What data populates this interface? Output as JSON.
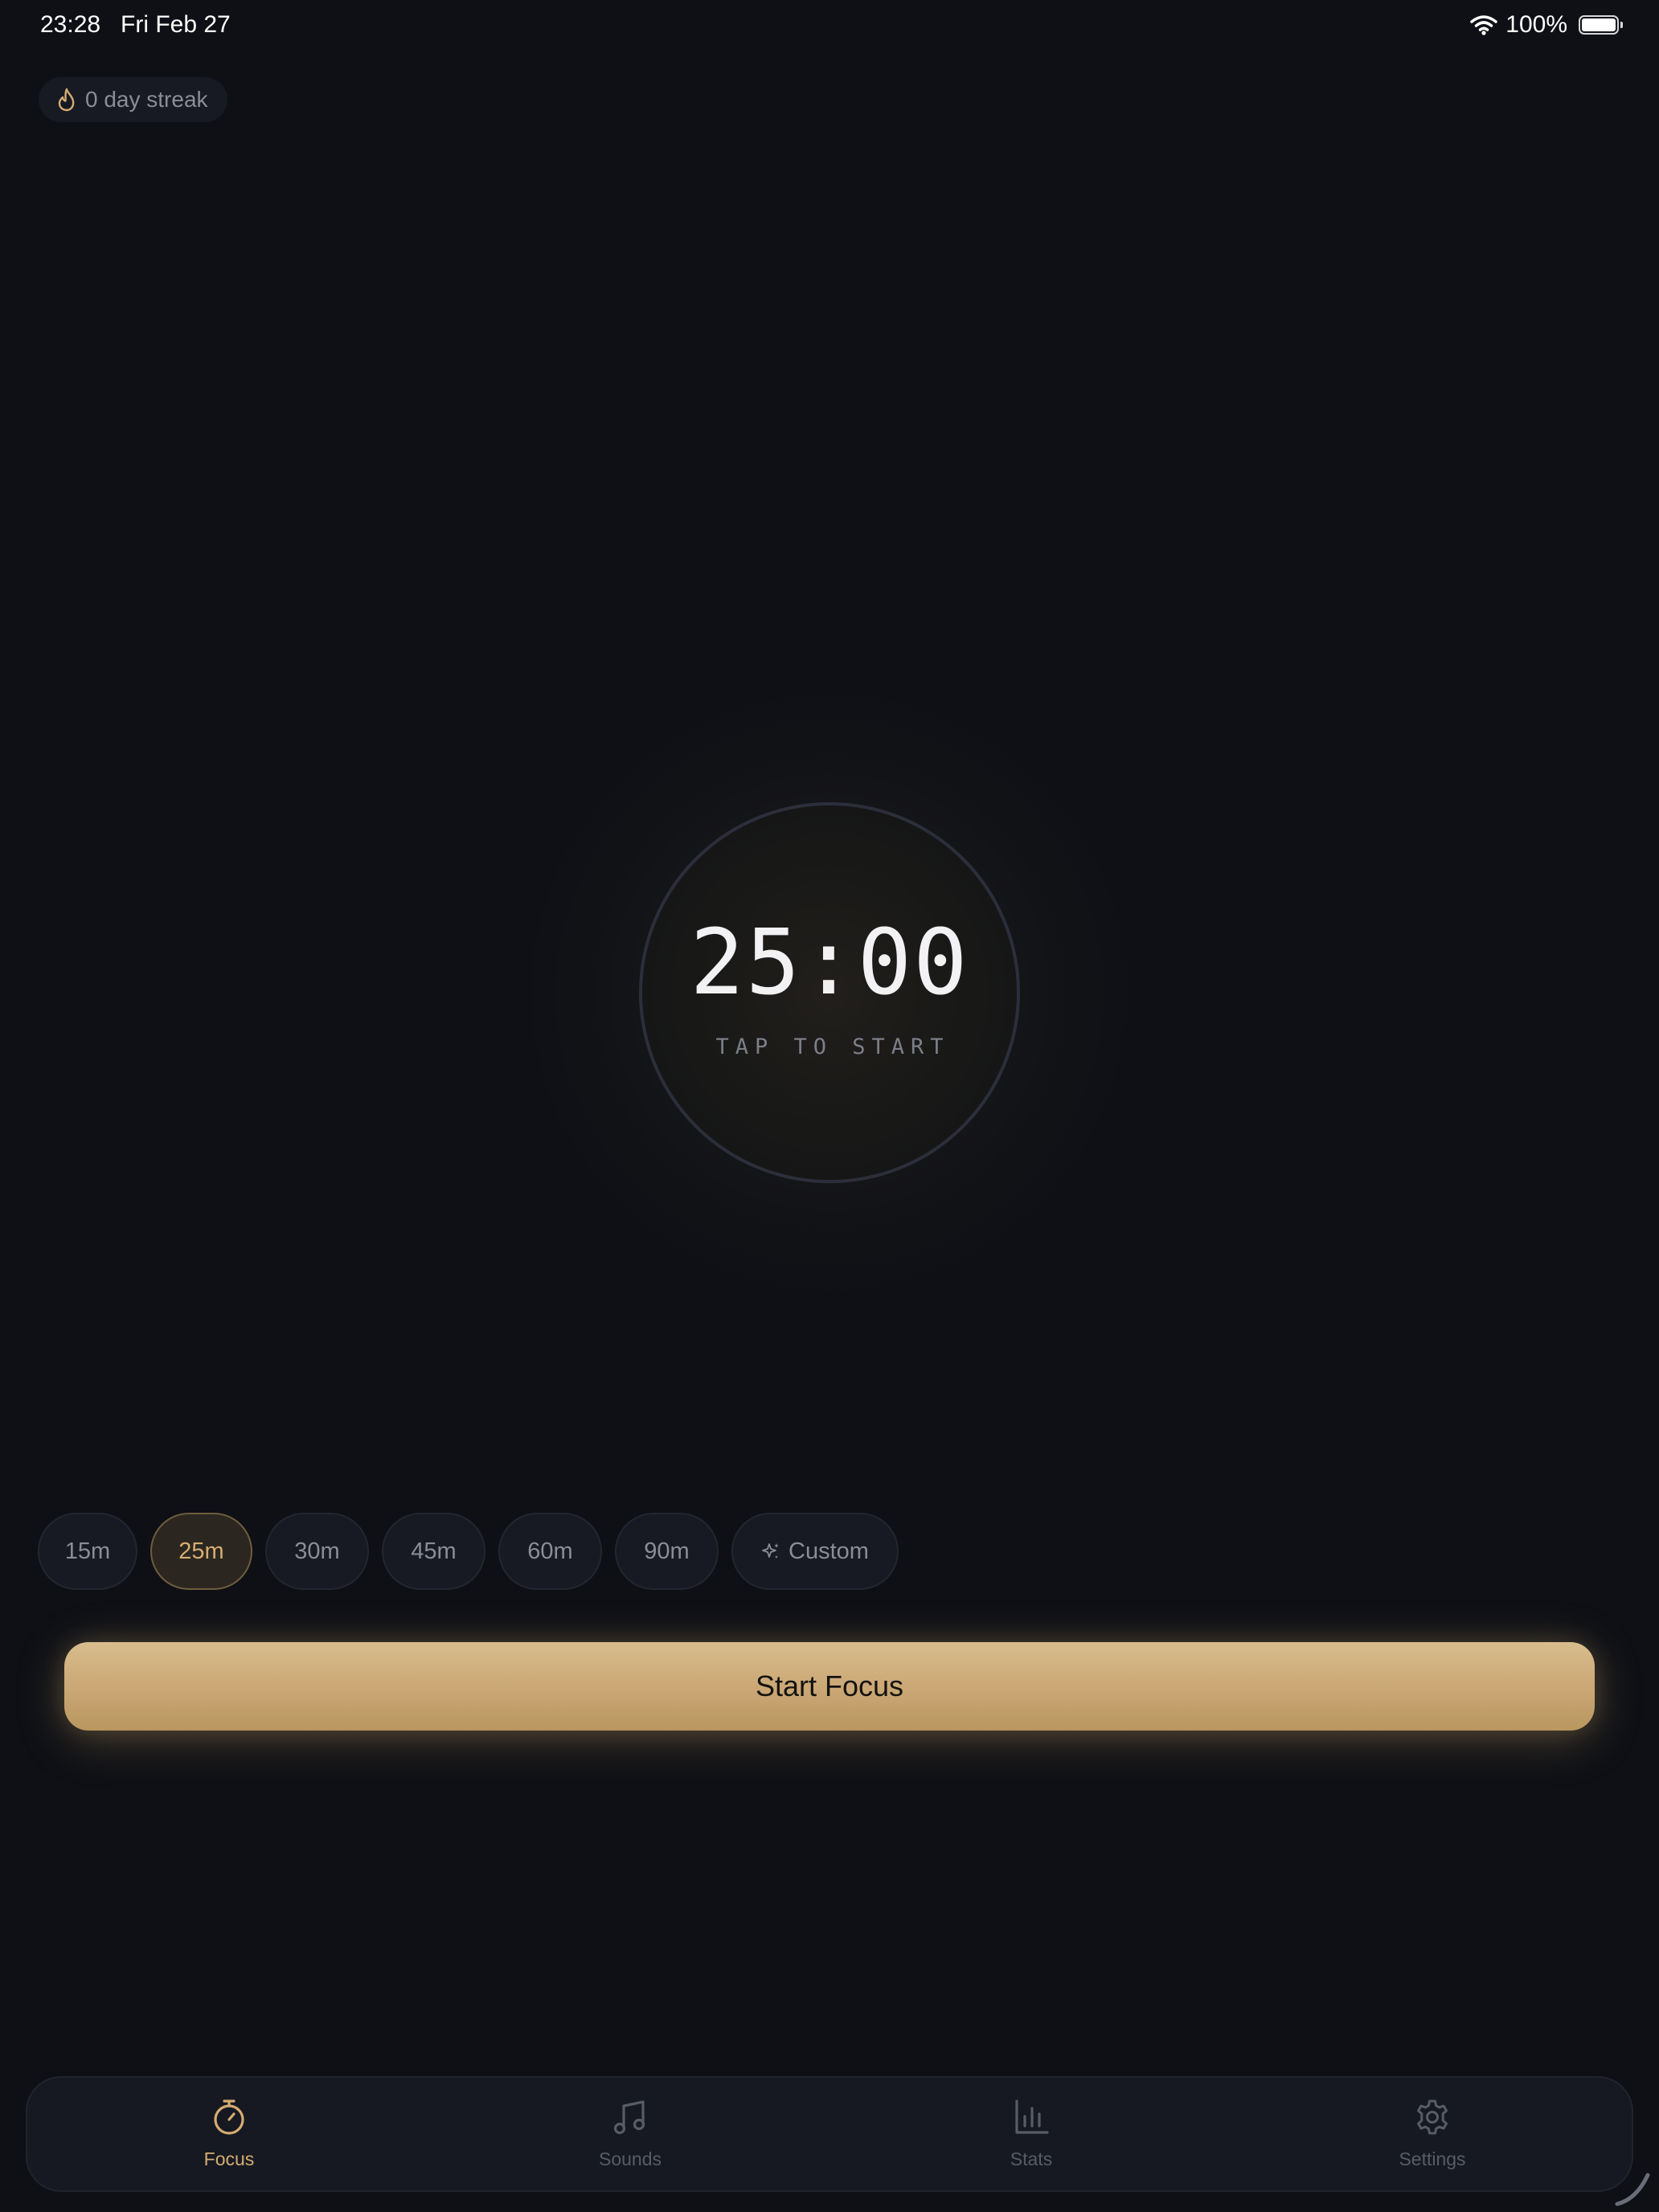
{
  "status_bar": {
    "time": "23:28",
    "date": "Fri Feb 27",
    "battery": "100%"
  },
  "streak": {
    "label": "0 day streak",
    "icon": "flame-icon"
  },
  "timer": {
    "display": "25:00",
    "hint": "TAP TO START"
  },
  "durations": {
    "options": [
      "15m",
      "25m",
      "30m",
      "45m",
      "60m",
      "90m"
    ],
    "selected": "25m",
    "custom_label": "Custom",
    "custom_icon": "sparkle-icon"
  },
  "start_button": {
    "label": "Start Focus"
  },
  "tabs": [
    {
      "label": "Focus",
      "icon": "stopwatch-icon",
      "active": true
    },
    {
      "label": "Sounds",
      "icon": "music-note-icon",
      "active": false
    },
    {
      "label": "Stats",
      "icon": "bar-chart-icon",
      "active": false
    },
    {
      "label": "Settings",
      "icon": "gear-icon",
      "active": false
    }
  ],
  "colors": {
    "background": "#0e1015",
    "accent": "#d6ac72",
    "button_gold": "#cba876",
    "muted_text": "#8a8d97",
    "surface": "#171a22"
  }
}
